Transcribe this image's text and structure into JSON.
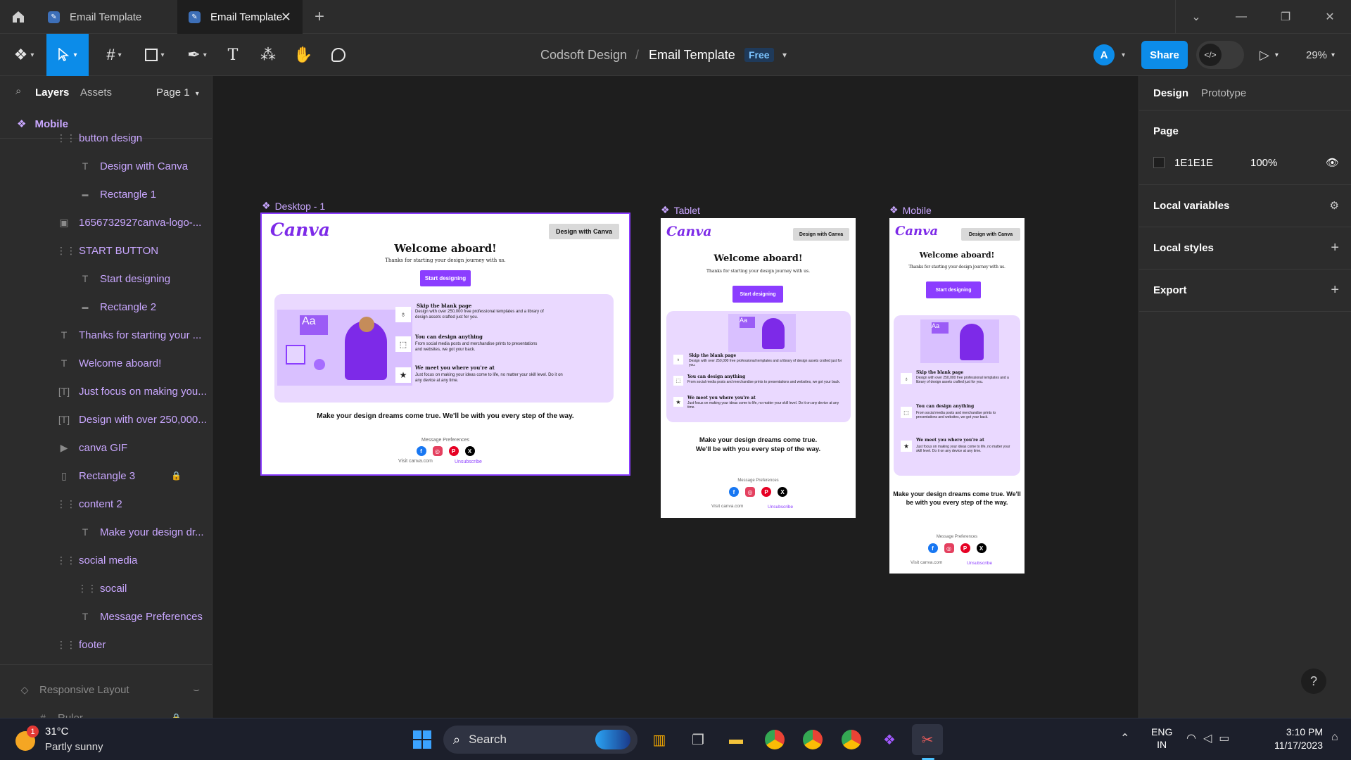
{
  "titlebar": {
    "tabs": [
      {
        "label": "Email Template",
        "active": false
      },
      {
        "label": "Email Template",
        "active": true
      }
    ],
    "new_tab": "+"
  },
  "toolbar": {
    "project": "Codsoft Design",
    "separator": "/",
    "file": "Email Template",
    "plan_badge": "Free",
    "avatar_initial": "A",
    "share_label": "Share",
    "zoom": "29%"
  },
  "left_panel": {
    "tab_layers": "Layers",
    "tab_assets": "Assets",
    "page_selector": "Page 1",
    "root_frame": "Mobile",
    "layers": [
      {
        "label": "button design",
        "icon": "grid-icon",
        "indent": 1
      },
      {
        "label": "Design with Canva",
        "icon": "text-icon",
        "indent": 2
      },
      {
        "label": "Rectangle 1",
        "icon": "rectangle-icon",
        "indent": 2
      },
      {
        "label": "1656732927canva-logo-...",
        "icon": "image-icon",
        "indent": 1
      },
      {
        "label": "START BUTTON",
        "icon": "grid-icon",
        "indent": 1
      },
      {
        "label": "Start designing",
        "icon": "text-icon",
        "indent": 2
      },
      {
        "label": "Rectangle 2",
        "icon": "rectangle-icon",
        "indent": 2
      },
      {
        "label": "Thanks for starting your ...",
        "icon": "text-icon",
        "indent": 1
      },
      {
        "label": "Welcome aboard!",
        "icon": "text-icon",
        "indent": 1
      },
      {
        "label": "Just focus on making you...",
        "icon": "textbox-icon",
        "indent": 1
      },
      {
        "label": "Design with over 250,000...",
        "icon": "textbox-icon",
        "indent": 1
      },
      {
        "label": "canva GIF",
        "icon": "gif-icon",
        "indent": 1
      },
      {
        "label": "Rectangle 3",
        "icon": "rect-outline-icon",
        "indent": 1,
        "locked": true
      },
      {
        "label": "content 2",
        "icon": "grid-icon",
        "indent": 1
      },
      {
        "label": "Make your design dr...",
        "icon": "text-icon",
        "indent": 2
      },
      {
        "label": "social media",
        "icon": "grid-icon",
        "indent": 1
      },
      {
        "label": "socail",
        "icon": "grid-icon",
        "indent": 2
      },
      {
        "label": "Message Preferences",
        "icon": "text-icon",
        "indent": 2
      },
      {
        "label": "footer",
        "icon": "grid-icon",
        "indent": 1
      }
    ],
    "bottom_layers": [
      {
        "label": "Responsive Layout"
      },
      {
        "label": "Ruler"
      }
    ]
  },
  "canvas": {
    "frames": [
      {
        "label": "Desktop - 1",
        "logo": "Canva",
        "cta_top": "Design with Canva",
        "heading": "Welcome aboard!",
        "subheading": "Thanks for starting your design journey with us.",
        "start_button": "Start designing",
        "features": [
          {
            "title": "Skip the blank page",
            "desc": "Design with over 250,000 free professional templates and a library of design assets crafted just for you."
          },
          {
            "title": "You can design anything",
            "desc": "From social media posts and merchandise prints to presentations and websites, we got your back."
          },
          {
            "title": "We meet you where you're at",
            "desc": "Just focus on making your ideas come to life, no matter your skill level. Do it on any device at any time."
          }
        ],
        "dream": "Make your design dreams come true. We'll be with you every step of the way.",
        "message_preferences": "Message Preferences",
        "visit": "Visit  canva.com",
        "unsubscribe": "Unsubscribe"
      },
      {
        "label": "Tablet",
        "logo": "Canva",
        "cta_top": "Design with Canva",
        "heading": "Welcome aboard!",
        "subheading": "Thanks for starting your design journey with us.",
        "start_button": "Start designing",
        "features": [
          {
            "title": "Skip the blank page",
            "desc": "Design with over 250,000 free professional templates and a library of design assets crafted just for you."
          },
          {
            "title": "You can design anything",
            "desc": "From social media posts and merchandise prints to presentations and websites, we got your back."
          },
          {
            "title": "We meet you where you're at",
            "desc": "Just focus on making your ideas come to life, no matter your skill level. Do it on any device at any time."
          }
        ],
        "dream_line1": "Make your design dreams come true.",
        "dream_line2": "We'll be with you every step of the way.",
        "message_preferences": "Message Preferences",
        "visit": "Visit  canva.com",
        "unsubscribe": "Unsubscribe"
      },
      {
        "label": "Mobile",
        "logo": "Canva",
        "cta_top": "Design with Canva",
        "heading": "Welcome aboard!",
        "subheading": "Thanks for starting your design journey with us.",
        "start_button": "Start designing",
        "features": [
          {
            "title": "Skip the blank page",
            "desc": "Design with over 250,000 free professional templates and a library of design assets crafted just for you."
          },
          {
            "title": "You can design anything",
            "desc": "From social media posts and merchandise prints to presentations and websites, we got your back."
          },
          {
            "title": "We meet you where you're at",
            "desc": "Just focus on making your ideas come to life, no matter your skill level. Do it on any device at any time."
          }
        ],
        "dream": "Make your design dreams come true. We'll be with you every step of the way.",
        "message_preferences": "Message Preferences",
        "visit": "Visit  canva.com",
        "unsubscribe": "Unsubscribe"
      }
    ]
  },
  "right_panel": {
    "tab_design": "Design",
    "tab_prototype": "Prototype",
    "page_section": "Page",
    "page_color": "1E1E1E",
    "page_opacity": "100%",
    "local_variables": "Local variables",
    "local_styles": "Local styles",
    "export": "Export",
    "help": "?"
  },
  "taskbar": {
    "weather_temp": "31°C",
    "weather_desc": "Partly sunny",
    "weather_badge": "1",
    "search_label": "Search",
    "lang_line1": "ENG",
    "lang_line2": "IN",
    "time": "3:10 PM",
    "date": "11/17/2023"
  },
  "colors": {
    "accent": "#0c8ce9",
    "selection": "#8b3dff",
    "layer_text": "#c9a7ff",
    "canva_purple": "#7d2ae8"
  }
}
